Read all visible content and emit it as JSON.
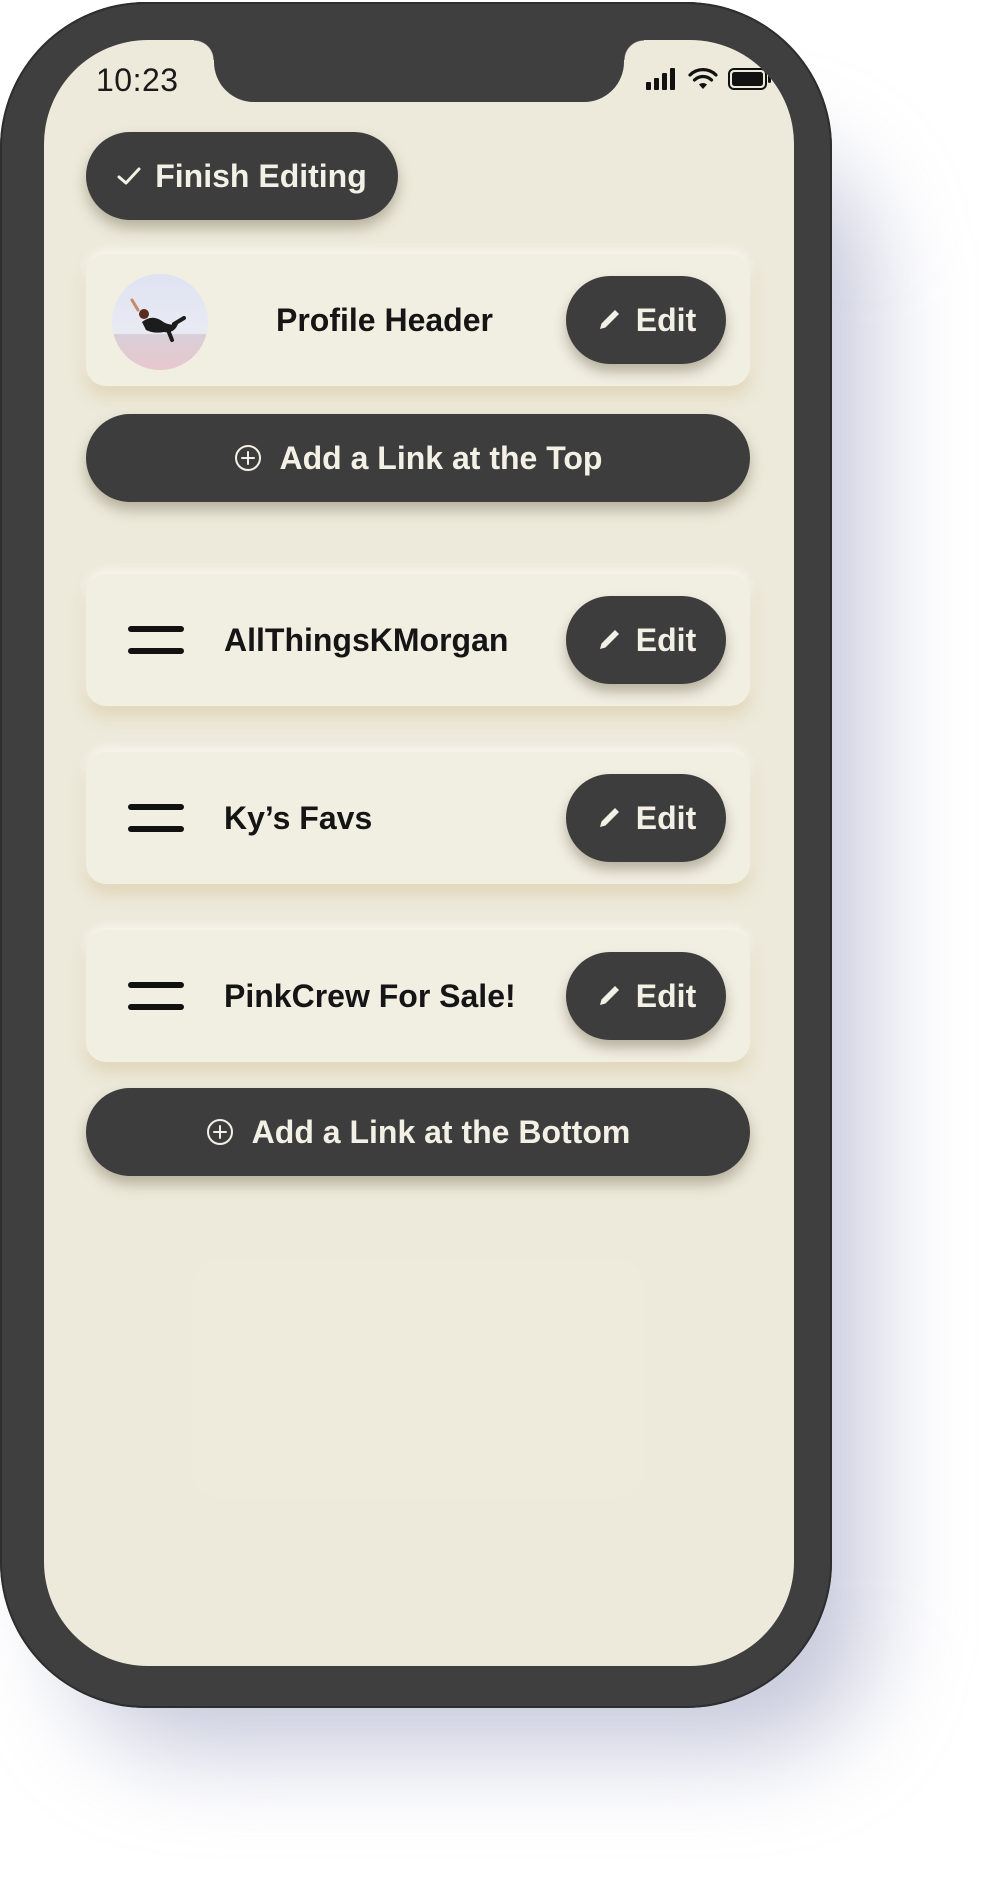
{
  "status_bar": {
    "time": "10:23"
  },
  "toolbar": {
    "finish_label": "Finish Editing"
  },
  "profile_card": {
    "title": "Profile Header",
    "edit_label": "Edit"
  },
  "add_top": {
    "label": "Add a Link at the Top"
  },
  "links": [
    {
      "title": "AllThingsKMorgan",
      "edit_label": "Edit"
    },
    {
      "title": "Ky’s Favs",
      "edit_label": "Edit"
    },
    {
      "title": "PinkCrew For Sale!",
      "edit_label": "Edit"
    }
  ],
  "add_bottom": {
    "label": "Add a Link at the Bottom"
  },
  "colors": {
    "screen_bg": "#edeadb",
    "phone_body": "#3f3f3f",
    "dark_button": "#3d3d3d",
    "button_text": "#f3f1e6"
  }
}
